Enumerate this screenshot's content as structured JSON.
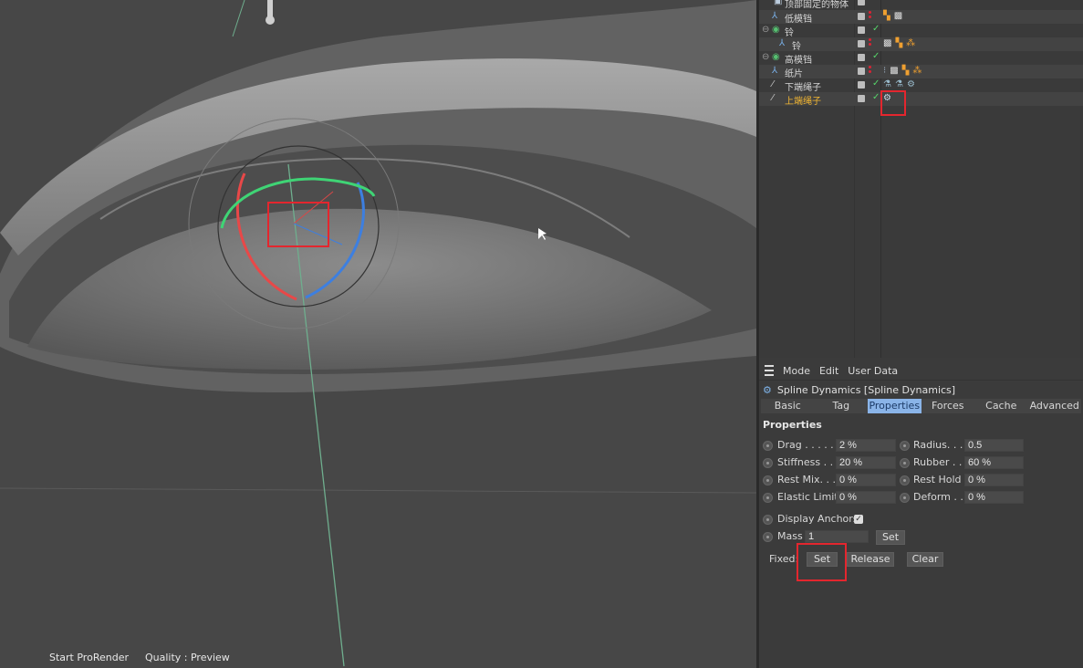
{
  "viewport": {
    "status": {
      "render": "Start ProRender",
      "quality": "Quality : Preview"
    }
  },
  "object_manager": {
    "objects": [
      {
        "name": "顶部固定的物体",
        "selected": false
      },
      {
        "name": "低模铛",
        "selected": false
      },
      {
        "name": "铃",
        "selected": false
      },
      {
        "name": "铃",
        "selected": false
      },
      {
        "name": "高模铛",
        "selected": false
      },
      {
        "name": "纸片",
        "selected": false
      },
      {
        "name": "下端绳子",
        "selected": false
      },
      {
        "name": "上端绳子",
        "selected": true
      }
    ]
  },
  "attributes": {
    "menu": {
      "mode": "Mode",
      "edit": "Edit",
      "user_data": "User Data"
    },
    "tag_title": "Spline Dynamics [Spline Dynamics]",
    "tabs": [
      "Basic",
      "Tag",
      "Properties",
      "Forces",
      "Cache",
      "Advanced"
    ],
    "active_tab": "Properties",
    "section": "Properties",
    "params_left": [
      {
        "label": "Drag . . . . .",
        "value": "2 %"
      },
      {
        "label": "Stiffness . . .",
        "value": "20 %"
      },
      {
        "label": "Rest Mix. . .",
        "value": "0 %"
      },
      {
        "label": "Elastic Limit",
        "value": "0 %"
      }
    ],
    "params_right": [
      {
        "label": "Radius. . . .",
        "value": "0.5"
      },
      {
        "label": "Rubber . . .",
        "value": "60 %"
      },
      {
        "label": "Rest Hold",
        "value": "0 %"
      },
      {
        "label": "Deform . . .",
        "value": "0 %"
      }
    ],
    "display_anchors": {
      "label": "Display Anchors",
      "checked": true
    },
    "mass": {
      "label": "Mass",
      "value": "1",
      "set_label": "Set"
    },
    "fixed": {
      "label": "Fixed:",
      "set_label": "Set",
      "release_label": "Release",
      "clear_label": "Clear"
    }
  },
  "colors": {
    "accent_tab": "#8ab4e8",
    "highlight_box": "#e4262e",
    "selected_object": "#f2b632"
  }
}
